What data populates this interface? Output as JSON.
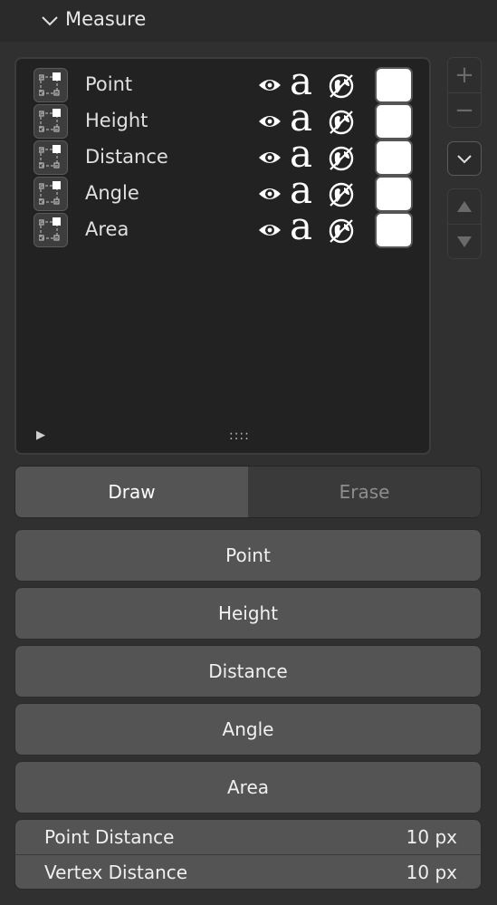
{
  "panel": {
    "title": "Measure"
  },
  "list": {
    "items": [
      {
        "name": "Point",
        "color": "#ffffff"
      },
      {
        "name": "Height",
        "color": "#ffffff"
      },
      {
        "name": "Distance",
        "color": "#ffffff"
      },
      {
        "name": "Angle",
        "color": "#ffffff"
      },
      {
        "name": "Area",
        "color": "#ffffff"
      }
    ],
    "text_glyph": "a",
    "grip": "::::",
    "expand_arrow": "▶"
  },
  "side_buttons": {
    "add": "+",
    "remove": "−",
    "menu_icon": "chevron-down-icon",
    "move_up_icon": "triangle-up-icon",
    "move_down_icon": "triangle-down-icon"
  },
  "mode": {
    "options": [
      "Draw",
      "Erase"
    ],
    "selected": "Draw"
  },
  "tools": {
    "point": "Point",
    "height": "Height",
    "distance": "Distance",
    "angle": "Angle",
    "area": "Area"
  },
  "settings": {
    "point_distance": {
      "label": "Point Distance",
      "value": "10 px"
    },
    "vertex_distance": {
      "label": "Vertex Distance",
      "value": "10 px"
    }
  },
  "colors": {
    "background": "#303030",
    "list_bg": "#222222",
    "button": "#545454",
    "button_inactive": "#3a3a3a"
  }
}
